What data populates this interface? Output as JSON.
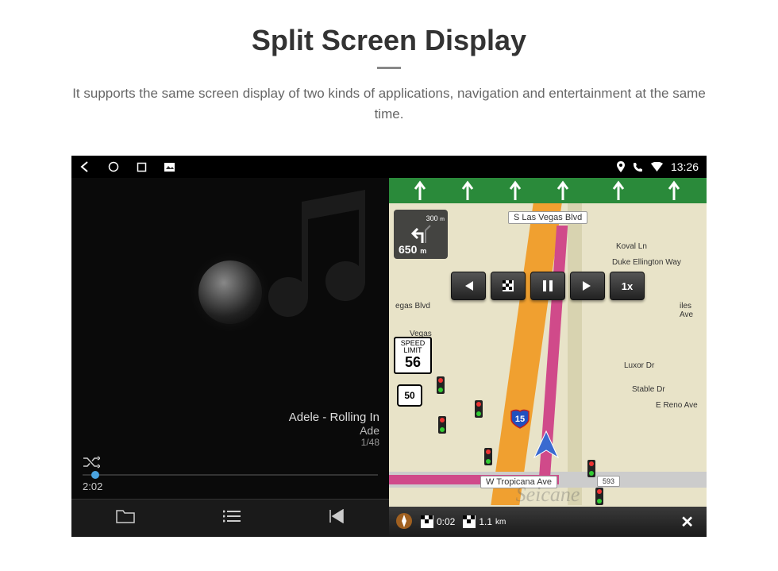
{
  "header": {
    "title": "Split Screen Display",
    "subtitle": "It supports the same screen display of two kinds of applications, navigation and entertainment at the same time."
  },
  "statusbar": {
    "time": "13:26"
  },
  "music": {
    "track_title": "Adele - Rolling In",
    "track_artist": "Ade",
    "track_count": "1/48",
    "elapsed": "2:02"
  },
  "nav": {
    "lanes": [
      "↓",
      "↓",
      "↓",
      "↓",
      "↓",
      "↓"
    ],
    "turn": {
      "next_dist": "300",
      "next_unit": "m",
      "main_dist": "650",
      "main_unit": "m"
    },
    "controls": {
      "prev": "⏮",
      "flag": "⚑",
      "pause": "⏸",
      "next": "⏭",
      "speed": "1x"
    },
    "speed_limit": {
      "label": "SPEED LIMIT",
      "value": "56"
    },
    "route_sign": "50",
    "interstate": "15",
    "streets": {
      "top": "S Las Vegas Blvd",
      "right1": "Koval Ln",
      "right2": "Duke Ellington Way",
      "right3": "Luxor Dr",
      "right4": "E Reno Ave",
      "right5": "Stable Dr",
      "left1": "egas Blvd",
      "vegas": "Vegas",
      "iles": "iles Ave",
      "bottom": "W Tropicana Ave",
      "bottom_num": "593"
    },
    "bottom": {
      "time": "0:02",
      "dist": "1.1",
      "dist_unit": "km"
    },
    "watermark": "Seicane"
  }
}
